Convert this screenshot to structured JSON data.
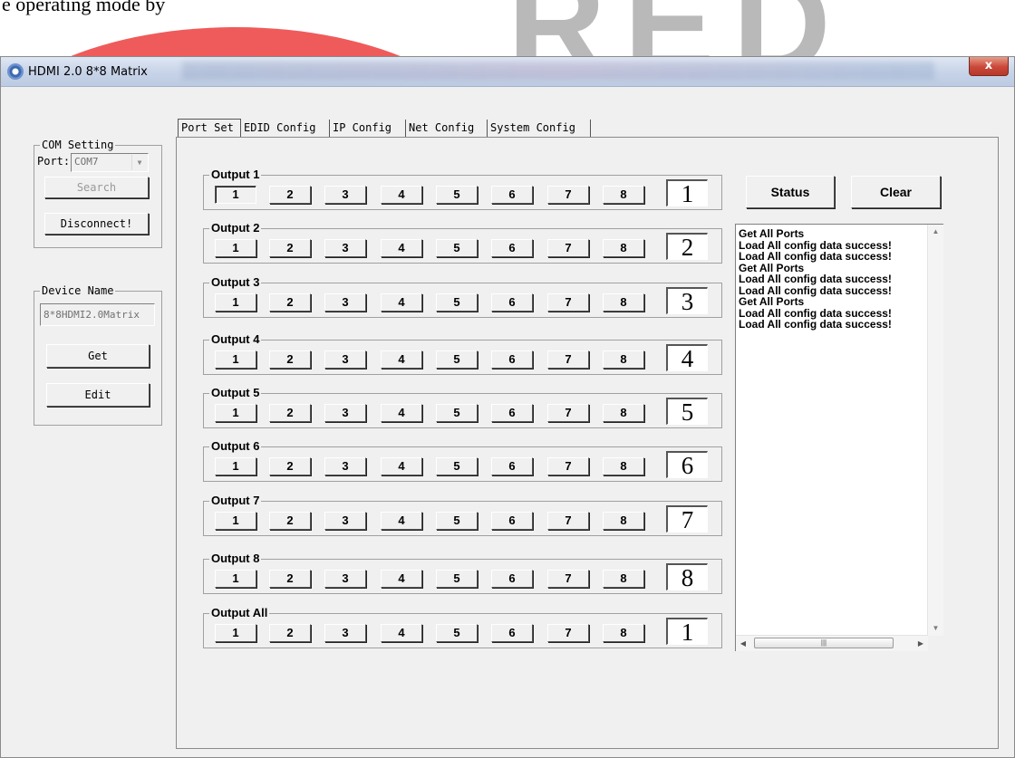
{
  "background": {
    "top_text": "e operating mode by"
  },
  "window": {
    "title": "HDMI 2.0 8*8 Matrix",
    "close_label": "x"
  },
  "com_setting": {
    "legend": "COM Setting",
    "port_label": "Port:",
    "port_value": "COM7",
    "search_label": "Search",
    "disconnect_label": "Disconnect!"
  },
  "device": {
    "legend": "Device Name",
    "name_value": "8*8HDMI2.0Matrix",
    "get_label": "Get",
    "edit_label": "Edit"
  },
  "tabs": [
    {
      "label": "Port Set",
      "active": true
    },
    {
      "label": "EDID Config",
      "active": false
    },
    {
      "label": "IP Config",
      "active": false
    },
    {
      "label": "Net Config",
      "active": false
    },
    {
      "label": "System Config",
      "active": false
    }
  ],
  "outputs": [
    {
      "label": "Output 1",
      "current": "1"
    },
    {
      "label": "Output 2",
      "current": "2"
    },
    {
      "label": "Output 3",
      "current": "3"
    },
    {
      "label": "Output 4",
      "current": "4"
    },
    {
      "label": "Output 5",
      "current": "5"
    },
    {
      "label": "Output 6",
      "current": "6"
    },
    {
      "label": "Output 7",
      "current": "7"
    },
    {
      "label": "Output 8",
      "current": "8"
    },
    {
      "label": "Output All",
      "current": "1"
    }
  ],
  "inputs": [
    "1",
    "2",
    "3",
    "4",
    "5",
    "6",
    "7",
    "8"
  ],
  "actions": {
    "status_label": "Status",
    "clear_label": "Clear"
  },
  "log": {
    "lines": [
      "Get All Ports",
      "Load All config data success!",
      "Load All config data success!",
      "Get All Ports",
      "Load All config data success!",
      "Load All config data success!",
      "Get All Ports",
      "Load All config data success!",
      "Load All config data success!"
    ]
  }
}
